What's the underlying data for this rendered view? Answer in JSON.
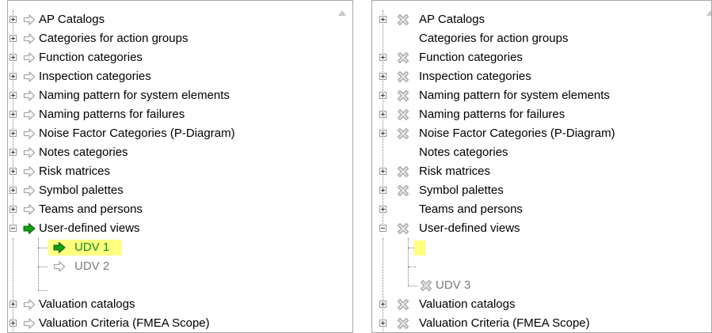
{
  "left_tree": {
    "items": [
      {
        "label": "AP Catalogs"
      },
      {
        "label": "Categories for action groups"
      },
      {
        "label": "Function categories"
      },
      {
        "label": "Inspection categories"
      },
      {
        "label": "Naming pattern for system elements"
      },
      {
        "label": "Naming patterns for failures"
      },
      {
        "label": "Noise Factor Categories (P-Diagram)"
      },
      {
        "label": "Notes categories"
      },
      {
        "label": "Risk matrices"
      },
      {
        "label": "Symbol palettes"
      },
      {
        "label": "Teams and persons"
      },
      {
        "label": "User-defined views"
      },
      {
        "label": "UDV 1"
      },
      {
        "label": "UDV 2"
      },
      {
        "label": "Valuation catalogs"
      },
      {
        "label": "Valuation Criteria (FMEA Scope)"
      }
    ]
  },
  "right_tree": {
    "items": [
      {
        "label": "AP Catalogs"
      },
      {
        "label": "Categories for action groups"
      },
      {
        "label": "Function categories"
      },
      {
        "label": "Inspection categories"
      },
      {
        "label": "Naming pattern for system elements"
      },
      {
        "label": "Naming patterns for failures"
      },
      {
        "label": "Noise Factor Categories (P-Diagram)"
      },
      {
        "label": "Notes categories"
      },
      {
        "label": "Risk matrices"
      },
      {
        "label": "Symbol palettes"
      },
      {
        "label": "Teams and persons"
      },
      {
        "label": "User-defined views"
      },
      {
        "label": "UDV 3"
      },
      {
        "label": "Valuation catalogs"
      },
      {
        "label": "Valuation Criteria (FMEA Scope)"
      }
    ]
  },
  "colors": {
    "highlight": "#ffff80",
    "arrow_gray": "#a8a8a8",
    "arrow_green": "#10a010",
    "cross_gray": "#a0a0a0"
  },
  "icons": {
    "arrow": "right-arrow-icon",
    "arrow_active": "green-right-arrow-icon",
    "cross": "cross-icon",
    "expand": "plus-box-icon",
    "collapse": "minus-box-icon"
  }
}
